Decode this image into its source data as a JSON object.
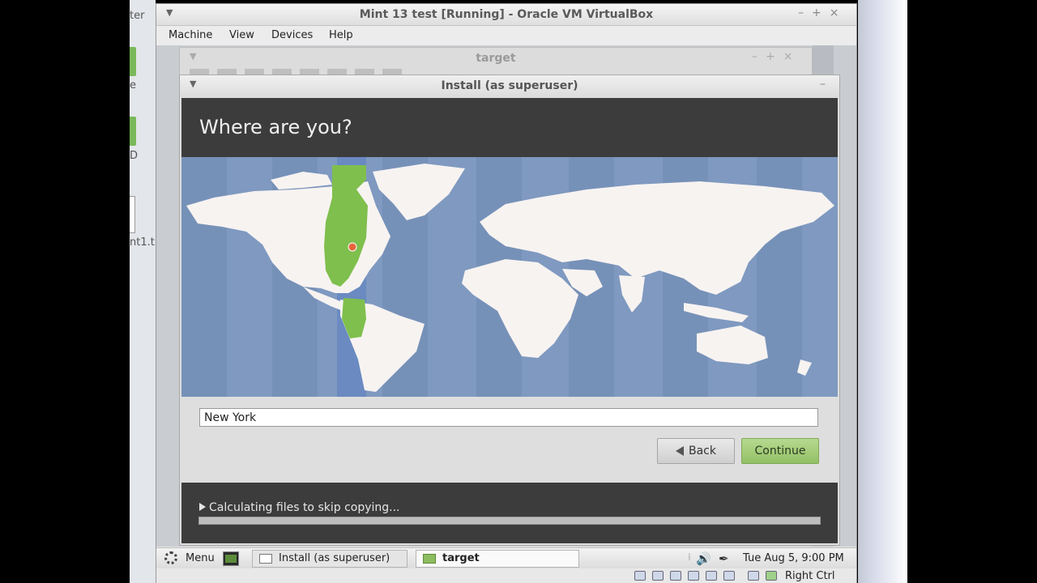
{
  "desktop": {
    "labels": [
      "ter",
      "e",
      "D",
      "nt1.t"
    ]
  },
  "vbox": {
    "title": "Mint 13 test [Running] - Oracle VM VirtualBox",
    "menu": [
      "Machine",
      "View",
      "Devices",
      "Help"
    ],
    "host_key": "Right Ctrl"
  },
  "target_window": {
    "title": "target"
  },
  "installer": {
    "title": "Install (as superuser)",
    "heading": "Where are you?",
    "location_value": "New York",
    "back_label": "Back",
    "continue_label": "Continue",
    "status_text": "Calculating files to skip copying...",
    "progress_percent": 0
  },
  "panel": {
    "menu_label": "Menu",
    "tasks": [
      "Install (as superuser)",
      "target"
    ],
    "clock": "Tue Aug  5,  9:00 PM"
  },
  "colors": {
    "map_ocean": "#7f99c0",
    "land": "#f7f3f1",
    "timezone_highlight": "#7fbf4d",
    "continue_green": "#a3cc79"
  }
}
